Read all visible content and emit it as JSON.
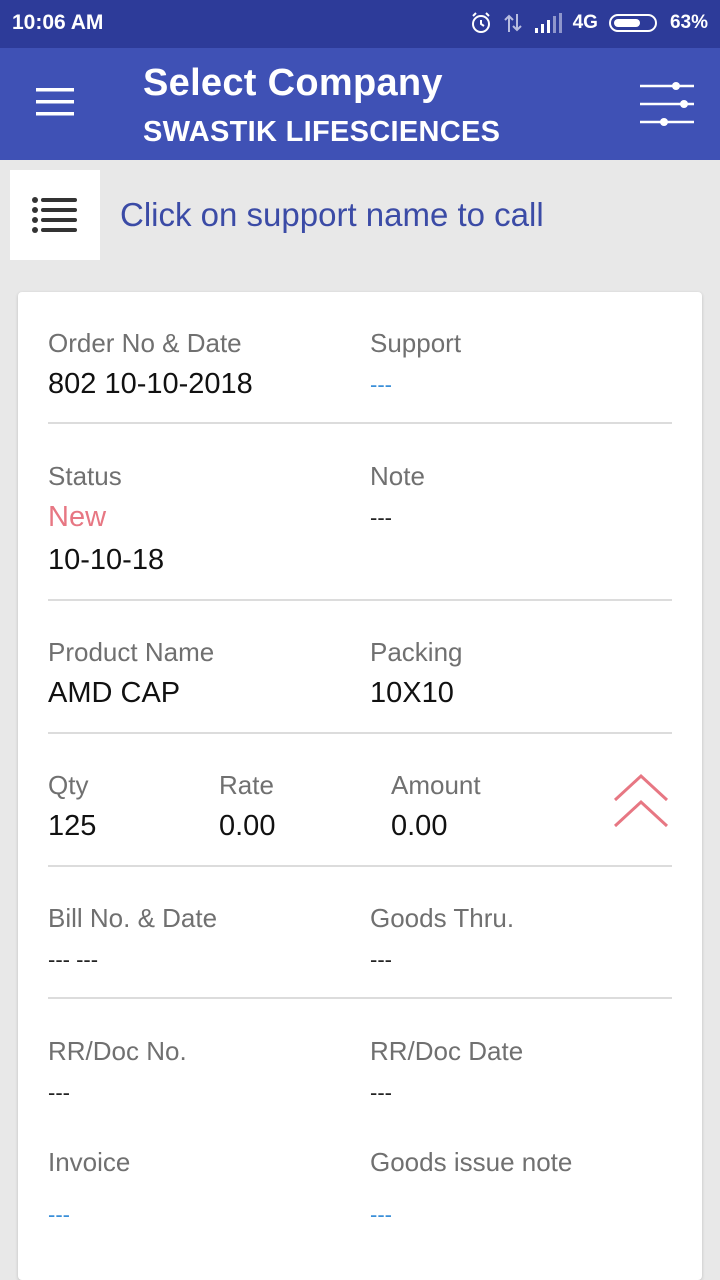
{
  "status_bar": {
    "time": "10:06 AM",
    "network": "4G",
    "battery": "63%"
  },
  "app_bar": {
    "title": "Select Company",
    "subtitle": "SWASTIK LIFESCIENCES"
  },
  "support_bar": {
    "text": "Click on support name to call"
  },
  "order": {
    "order_label": "Order No & Date",
    "order_value": "802 10-10-2018",
    "support_label": "Support",
    "support_value": "---",
    "status_label": "Status",
    "status_value": "New",
    "status_date": "10-10-18",
    "note_label": "Note",
    "note_value": "---",
    "product_label": "Product Name",
    "product_value": "AMD CAP",
    "packing_label": "Packing",
    "packing_value": "10X10",
    "qty_label": "Qty",
    "qty_value": "125",
    "rate_label": "Rate",
    "rate_value": "0.00",
    "amount_label": "Amount",
    "amount_value": "0.00",
    "bill_label": "Bill No. & Date",
    "bill_value": "--- ---",
    "goods_thru_label": "Goods Thru.",
    "goods_thru_value": "---",
    "rr_doc_no_label": "RR/Doc No.",
    "rr_doc_no_value": "---",
    "rr_doc_date_label": "RR/Doc Date",
    "rr_doc_date_value": "---",
    "invoice_label": "Invoice",
    "invoice_value": "---",
    "goods_issue_label": "Goods issue note",
    "goods_issue_value": "---"
  },
  "colors": {
    "status_bar": "#2d3b99",
    "app_bar": "#3f51b5",
    "accent_text": "#3b4ba6",
    "status_new": "#e77783",
    "link": "#3a8fd8"
  }
}
